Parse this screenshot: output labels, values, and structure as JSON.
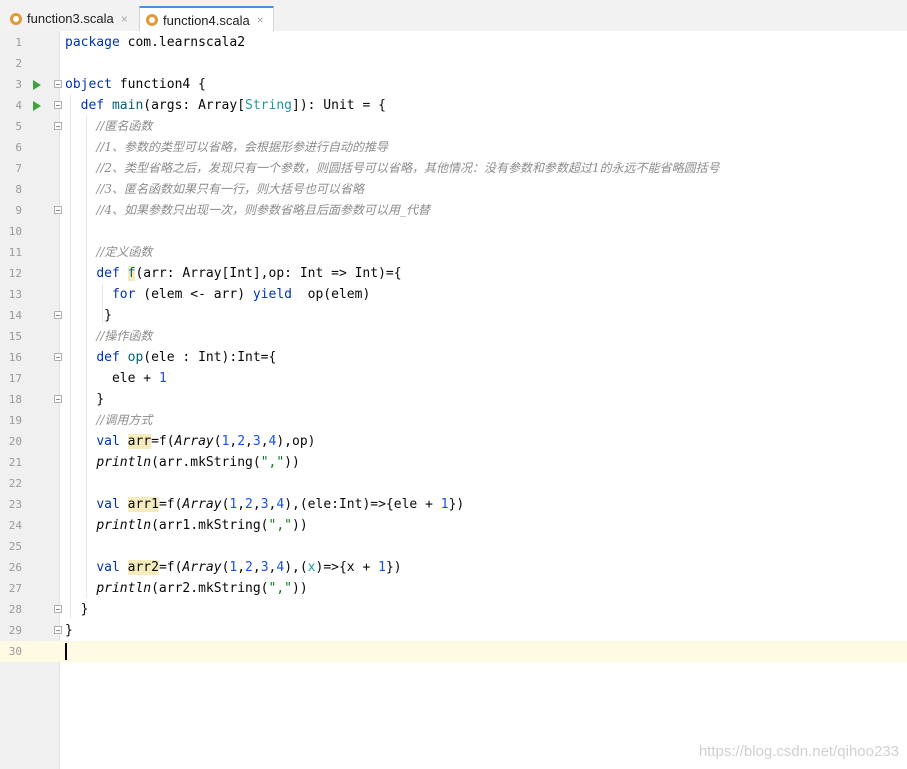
{
  "tabs": [
    {
      "label": "function3.scala",
      "close": "×",
      "icon": "scala-file-icon"
    },
    {
      "label": "function4.scala",
      "close": "×",
      "icon": "scala-file-icon",
      "active": true
    }
  ],
  "editor": {
    "line_numbers": [
      "1",
      "2",
      "3",
      "4",
      "5",
      "6",
      "7",
      "8",
      "9",
      "10",
      "11",
      "12",
      "13",
      "14",
      "15",
      "16",
      "17",
      "18",
      "19",
      "20",
      "21",
      "22",
      "23",
      "24",
      "25",
      "26",
      "27",
      "28",
      "29",
      "30"
    ],
    "lines": {
      "l1": [
        "package",
        " com.learnscala2"
      ],
      "l3": [
        "object",
        " function4 {"
      ],
      "l4": [
        "def",
        "main",
        "(args: Array[",
        "String",
        "]): Unit = {"
      ],
      "l5": "//匿名函数",
      "l6": "//1、参数的类型可以省略，会根据形参进行自动的推导",
      "l7": "//2、类型省略之后，发现只有一个参数，则圆括号可以省略，其他情况：没有参数和参数超过1的永远不能省略圆括号",
      "l8": "//3、匿名函数如果只有一行，则大括号也可以省略",
      "l9": "//4、如果参数只出现一次，则参数省略且后面参数可以用_代替",
      "l11": "//定义函数",
      "l12": [
        "def",
        "f",
        "(arr: Array[Int],op: Int => Int)={"
      ],
      "l13": [
        "for",
        " (elem <- arr) ",
        "yield",
        "  op(elem)"
      ],
      "l14": "}",
      "l15": "//操作函数",
      "l16": [
        "def",
        "op",
        "(ele : Int):Int={"
      ],
      "l17": [
        "ele + ",
        "1"
      ],
      "l18": "}",
      "l19": "//调用方式",
      "l20": [
        "val",
        "arr",
        "=f(",
        "Array",
        "(",
        "1",
        ",",
        "2",
        ",",
        "3",
        ",",
        "4",
        "),op)"
      ],
      "l21": [
        "println",
        "(arr.mkString(",
        "\",\"",
        "))"
      ],
      "l23": [
        "val",
        "arr1",
        "=f(",
        "Array",
        "(",
        "1",
        ",",
        "2",
        ",",
        "3",
        ",",
        "4",
        "),(ele:Int)=>{ele + ",
        "1",
        "})"
      ],
      "l24": [
        "println",
        "(arr1.mkString(",
        "\",\"",
        "))"
      ],
      "l26": [
        "val",
        "arr2",
        "=f(",
        "Array",
        "(",
        "1",
        ",",
        "2",
        ",",
        "3",
        ",",
        "4",
        "),(",
        "x",
        ")=>{x + ",
        "1",
        "})"
      ],
      "l27": [
        "println",
        "(arr2.mkString(",
        "\",\"",
        "))"
      ],
      "l28": "}",
      "l29": "}"
    }
  },
  "watermark": "https://blog.csdn.net/qihoo233",
  "colors": {
    "keyword": "#0033b3",
    "number": "#1750eb",
    "string": "#067d17",
    "comment": "#8c8c8c",
    "current_line": "#fffae3",
    "run_icon": "#3ea43e"
  }
}
